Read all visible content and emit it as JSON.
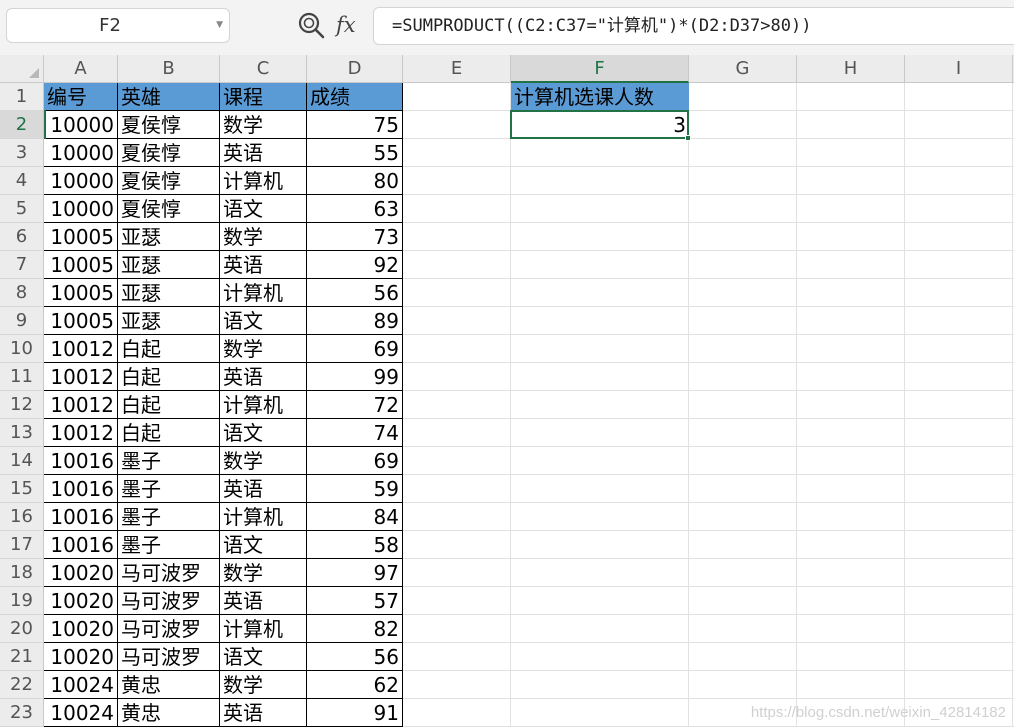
{
  "formula_bar": {
    "name_box": "F2",
    "fx_label": "fx",
    "formula": "=SUMPRODUCT((C2:C37=\"计算机\")*(D2:D37>80))"
  },
  "columns": [
    "A",
    "B",
    "C",
    "D",
    "E",
    "F",
    "G",
    "H",
    "I"
  ],
  "active_column": "F",
  "rows": [
    "1",
    "2",
    "3",
    "4",
    "5",
    "6",
    "7",
    "8",
    "9",
    "10",
    "11",
    "12",
    "13",
    "14",
    "15",
    "16",
    "17",
    "18",
    "19",
    "20",
    "21",
    "22",
    "23"
  ],
  "active_row": "2",
  "table": {
    "headers": [
      "编号",
      "英雄",
      "课程",
      "成绩"
    ],
    "rows": [
      [
        "10000",
        "夏侯惇",
        "数学",
        "75"
      ],
      [
        "10000",
        "夏侯惇",
        "英语",
        "55"
      ],
      [
        "10000",
        "夏侯惇",
        "计算机",
        "80"
      ],
      [
        "10000",
        "夏侯惇",
        "语文",
        "63"
      ],
      [
        "10005",
        "亚瑟",
        "数学",
        "73"
      ],
      [
        "10005",
        "亚瑟",
        "英语",
        "92"
      ],
      [
        "10005",
        "亚瑟",
        "计算机",
        "56"
      ],
      [
        "10005",
        "亚瑟",
        "语文",
        "89"
      ],
      [
        "10012",
        "白起",
        "数学",
        "69"
      ],
      [
        "10012",
        "白起",
        "英语",
        "99"
      ],
      [
        "10012",
        "白起",
        "计算机",
        "72"
      ],
      [
        "10012",
        "白起",
        "语文",
        "74"
      ],
      [
        "10016",
        "墨子",
        "数学",
        "69"
      ],
      [
        "10016",
        "墨子",
        "英语",
        "59"
      ],
      [
        "10016",
        "墨子",
        "计算机",
        "84"
      ],
      [
        "10016",
        "墨子",
        "语文",
        "58"
      ],
      [
        "10020",
        "马可波罗",
        "数学",
        "97"
      ],
      [
        "10020",
        "马可波罗",
        "英语",
        "57"
      ],
      [
        "10020",
        "马可波罗",
        "计算机",
        "82"
      ],
      [
        "10020",
        "马可波罗",
        "语文",
        "56"
      ],
      [
        "10024",
        "黄忠",
        "数学",
        "62"
      ],
      [
        "10024",
        "黄忠",
        "英语",
        "91"
      ]
    ]
  },
  "result": {
    "label": "计算机选课人数",
    "value": "3"
  },
  "colors": {
    "header_fill": "#5b9bd5",
    "selection": "#217346"
  },
  "watermark": "https://blog.csdn.net/weixin_42814182"
}
